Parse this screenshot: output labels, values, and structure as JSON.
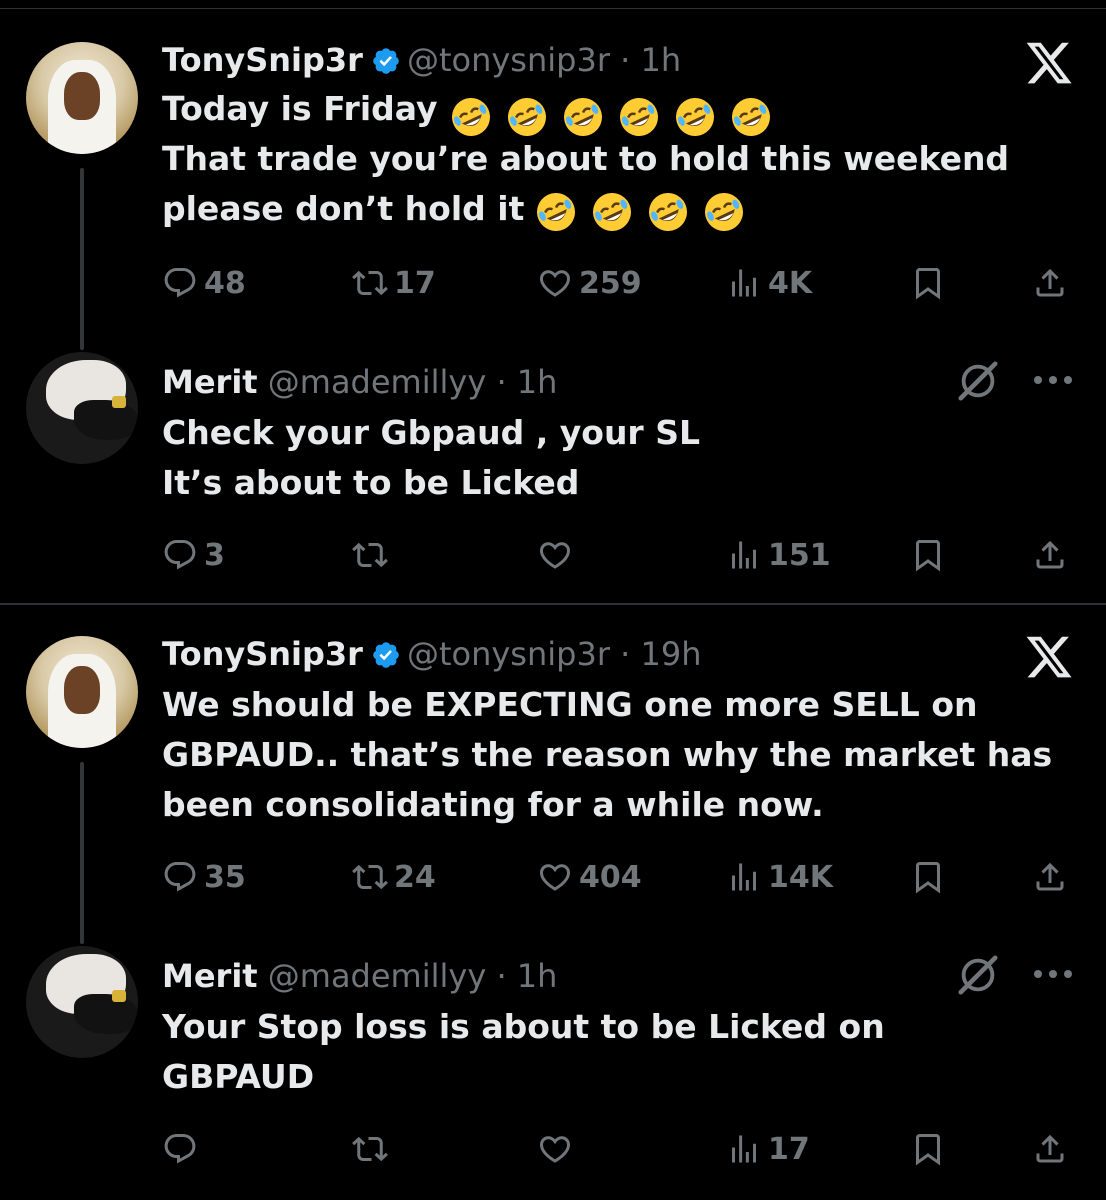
{
  "tweets": [
    {
      "author_name": "TonySnip3r",
      "handle": "@tonysnip3r",
      "time": "· 1h",
      "verified": true,
      "text_line1": "Today is Friday",
      "text_rest": "That trade you’re about to hold this weekend\nplease don’t hold it",
      "emoji_count_line1": 6,
      "emoji_count_line3": 4,
      "stats": {
        "replies": "48",
        "retweets": "17",
        "likes": "259",
        "views": "4K"
      }
    },
    {
      "author_name": "Merit",
      "handle": "@mademillyy",
      "time": "· 1h",
      "verified": false,
      "text": "Check your Gbpaud , your SL\nIt’s about to be Licked",
      "stats": {
        "replies": "3",
        "retweets": "",
        "likes": "",
        "views": "151"
      }
    },
    {
      "author_name": "TonySnip3r",
      "handle": "@tonysnip3r",
      "time": "· 19h",
      "verified": true,
      "text": "We should be EXPECTING one more SELL on\nGBPAUD.. that’s the reason why the market has\nbeen consolidating for a while now.",
      "stats": {
        "replies": "35",
        "retweets": "24",
        "likes": "404",
        "views": "14K"
      }
    },
    {
      "author_name": "Merit",
      "handle": "@mademillyy",
      "time": "· 1h",
      "verified": false,
      "text": "Your Stop loss is about to be Licked on\nGBPAUD",
      "stats": {
        "replies": "",
        "retweets": "",
        "likes": "",
        "views": "17"
      }
    }
  ],
  "icons": [
    "x-logo-icon",
    "verified-badge-icon",
    "reply-icon",
    "retweet-icon",
    "like-icon",
    "views-icon",
    "bookmark-icon",
    "share-icon",
    "grok-icon",
    "more-icon",
    "rofl-emoji-icon"
  ],
  "colors": {
    "background": "#000000",
    "text": "#e7e9ea",
    "muted": "#71767b",
    "verified": "#1d9bf0",
    "divider": "#2f3336",
    "emoji": "#ffcc33"
  }
}
